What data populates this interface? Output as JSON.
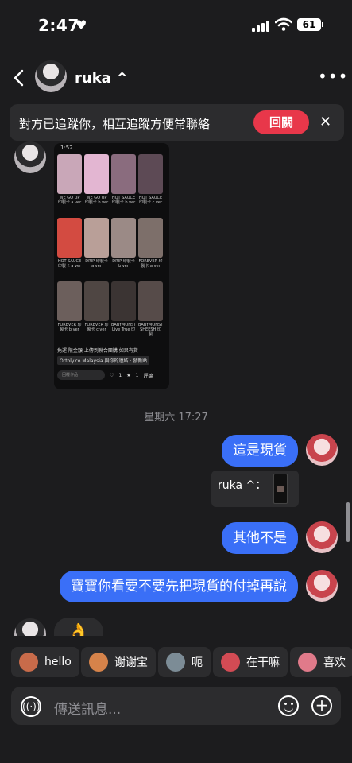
{
  "status_bar": {
    "time": "2:47",
    "heart": "♥",
    "battery": "61"
  },
  "header": {
    "contact_name": "ruka ^",
    "more": "•••"
  },
  "banner": {
    "text": "對方已追蹤你，相互追蹤方便常聯絡",
    "follow_back_label": "回關",
    "close": "✕"
  },
  "shared_screenshot": {
    "status_time": "1:52",
    "products": [
      {
        "caption": "WE GO UP 印製卡 a ver",
        "color": "#c9a7b8"
      },
      {
        "caption": "WE GO UP 印製卡 b ver",
        "color": "#e3b6d2"
      },
      {
        "caption": "HOT SAUCE 印製卡 b ver",
        "color": "#8a6c7e"
      },
      {
        "caption": "HOT SAUCE 印製卡 c ver",
        "color": "#5d4a55"
      },
      {
        "caption": "HOT SAUCE 印製卡 a ver",
        "color": "#d34b41"
      },
      {
        "caption": "DRIP 印製卡 a ver",
        "color": "#b99f98"
      },
      {
        "caption": "DRIP 印製卡 b ver",
        "color": "#9b8a86"
      },
      {
        "caption": "FOREVER 印製卡 a ver",
        "color": "#7d6f6a"
      },
      {
        "caption": "FOREVER 印製卡 b ver",
        "color": "#6c5f5c"
      },
      {
        "caption": "FOREVER 印製卡 c ver",
        "color": "#4f4643"
      },
      {
        "caption": "BABYMONSTER Live True 印",
        "color": "#3b3433"
      },
      {
        "caption": "BABYMONSTER SHEESH 印製",
        "color": "#564b49"
      }
    ],
    "promo_text": "免運 限金額 上傳到聯合團購 如果有貨",
    "tag_text": "Ortoly.co Malaysia 與你的連結 · 發新貼",
    "reply_placeholder": "回覆作品",
    "likes": "1",
    "stars": "1",
    "comment_label": "評論"
  },
  "thread": {
    "timestamp": "星期六 17:27",
    "messages": [
      {
        "text": "這是現貨"
      },
      {
        "text": "其他不是"
      },
      {
        "text": "寶寶你看要不要先把現貨的付掉再說"
      }
    ],
    "reply_preview": {
      "label": "ruka ^："
    },
    "last_incoming_emoji": "👌"
  },
  "quick_replies": [
    {
      "label": "hello",
      "color": "#c86b4a"
    },
    {
      "label": "谢谢宝",
      "color": "#d6834a"
    },
    {
      "label": "呃",
      "color": "#7c8c96"
    },
    {
      "label": "在干嘛",
      "color": "#d24b54"
    },
    {
      "label": "喜欢",
      "color": "#e07a8a"
    }
  ],
  "composer": {
    "placeholder": "傳送訊息..."
  },
  "colors": {
    "bubble_blue": "#3a6ff7",
    "accent_red": "#e8374a",
    "background": "#1c1c1e"
  }
}
